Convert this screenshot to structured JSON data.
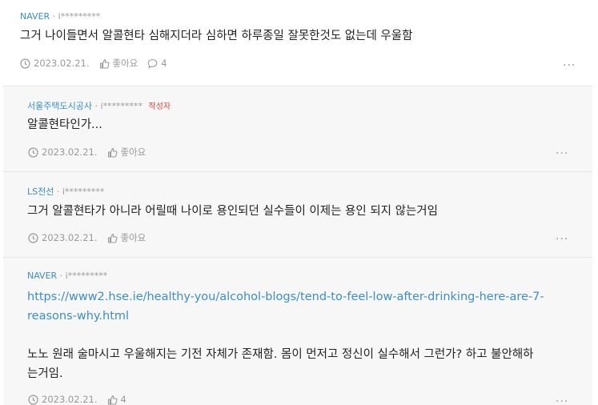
{
  "posts": [
    {
      "company": "NAVER",
      "user": "· i*********",
      "badge": "",
      "text": "그거 나이들면서 알콜현타 심해지더라 심하면 하루종일 잘못한것도 없는데 우울함",
      "date": "2023.02.21.",
      "like_label": "좋아요",
      "comment_count": "4"
    },
    {
      "company": "서울주택도시공사",
      "user": "· i*********",
      "badge": "작성자",
      "text": "알콜현타인가...",
      "date": "2023.02.21.",
      "like_label": "좋아요"
    },
    {
      "company": "LS전선",
      "user": "· i*********",
      "badge": "",
      "text": "그거 알콜현타가 아니라 어릴때 나이로 용인되던 실수들이 이제는 용인 되지 않는거임",
      "date": "2023.02.21.",
      "like_label": "좋아요"
    },
    {
      "company": "NAVER",
      "user": "· i*********",
      "badge": "",
      "link": "https://www2.hse.ie/healthy-you/alcohol-blogs/tend-to-feel-low-after-drinking-here-are-7-reasons-why.html",
      "link_line1": "https://www2.hse.ie/healthy-you/alcohol-blogs/tend-to-feel-low-after-drinking-here-are-7-",
      "link_line2": "reasons-why.html",
      "text_line1": "노노 원래 술마시고 우울해지는 기전 자체가 존재함. 몸이 먼저고 정신이 실수해서 그런가? 하고 불안해하",
      "text_line2": "는거임.",
      "date": "2023.02.21.",
      "like_count": "4"
    }
  ],
  "more_label": "...",
  "colors": {
    "company": "#3b8ec6",
    "badge": "#e0463c",
    "muted": "#999999",
    "reply_bg": "#f7f7f8"
  },
  "icons": [
    "clock-icon",
    "thumbs-up-icon",
    "comment-icon",
    "more-icon"
  ]
}
